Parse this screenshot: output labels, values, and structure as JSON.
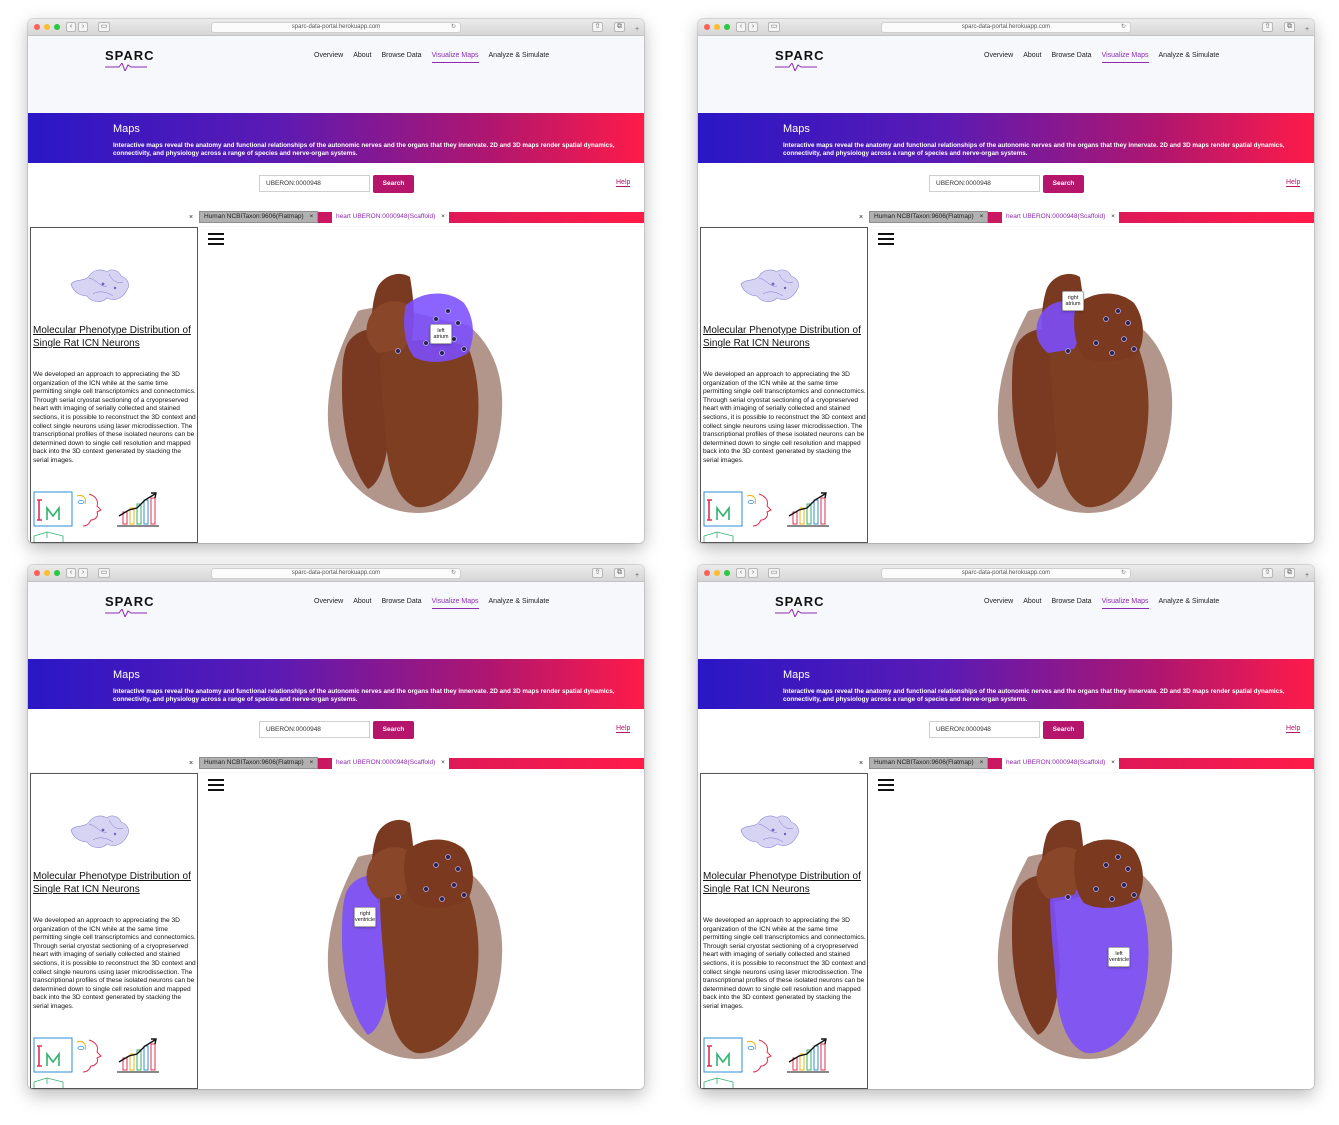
{
  "browser": {
    "url": "sparc-data-portal.herokuapp.com"
  },
  "site": {
    "logo": "SPARC",
    "nav": [
      "Overview",
      "About",
      "Browse Data",
      "Visualize Maps",
      "Analyze & Simulate"
    ],
    "active_nav": "Visualize Maps",
    "hero_title": "Maps",
    "hero_text": "Interactive maps reveal the anatomy and functional relationships of the autonomic nerves and the organs that they innervate. 2D and 3D maps render spatial dynamics, connectivity, and physiology across a range of species and nerve-organ systems.",
    "search_value": "UBERON:0000948",
    "search_button": "Search",
    "help_link": "Help",
    "tab_close": "×",
    "tabs": [
      {
        "label": "Human NCBITaxon:9606(Flatmap)",
        "close": "×"
      },
      {
        "label": "heart UBERON:0000948(Scaffold)",
        "close": "×"
      }
    ]
  },
  "panel": {
    "title": "Molecular Phenotype Distribution of Single Rat ICN Neurons",
    "body": "We developed an approach to appreciating the 3D organization of the ICN while at the same time permitting single cell transcriptomics and connectomics. Through serial cryostat sectioning of a cryopreserved heart with imaging of serially collected and stained sections, it is possible to reconstruct the 3D context and collect single neurons using laser microdissection. The transcriptional profiles of these isolated neurons can be determined down to single cell resolution and mapped back into the 3D context generated by stacking the serial images."
  },
  "screens": [
    {
      "highlight": "left-atrium",
      "tooltip_line1": "left",
      "tooltip_line2": "atrium"
    },
    {
      "highlight": "right-atrium",
      "tooltip_line1": "right",
      "tooltip_line2": "atrium"
    },
    {
      "highlight": "right-ventricle",
      "tooltip_line1": "right",
      "tooltip_line2": "ventricle"
    },
    {
      "highlight": "left-ventricle",
      "tooltip_line1": "left",
      "tooltip_line2": "ventricle"
    }
  ],
  "colors": {
    "brand": "#b5166c",
    "hero_start": "#2a17c6",
    "hero_end": "#ff1b49",
    "highlight": "#7b4dff",
    "heart_muscle": "#7a3a22",
    "heart_outer": "#a48478"
  },
  "icons": [
    "window-close-icon",
    "window-minimize-icon",
    "window-maximize-icon",
    "back-icon",
    "forward-icon",
    "sidebar-icon",
    "reload-icon",
    "share-icon",
    "tabs-icon",
    "new-tab-icon",
    "menu-icon",
    "rat-heart-thumbnail",
    "microscopy-icon",
    "face-profile-icon",
    "growth-chart-icon"
  ]
}
